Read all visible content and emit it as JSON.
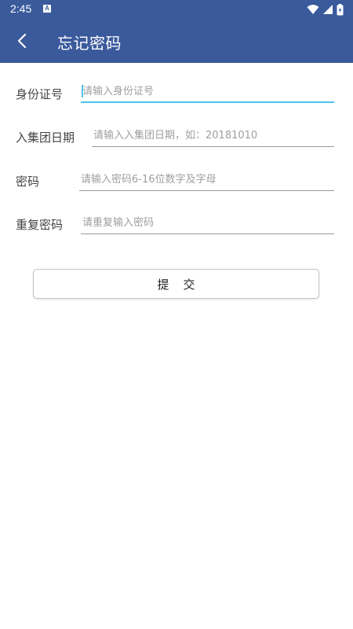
{
  "status_bar": {
    "time": "2:45",
    "notification_icon": "A",
    "icons": [
      "wifi-icon",
      "cellular-signal-icon",
      "battery-charging-icon"
    ]
  },
  "app_bar": {
    "title": "忘记密码",
    "back_icon": "chevron-left-icon",
    "background_color": "#3a5a9c"
  },
  "form": {
    "fields": [
      {
        "label": "身份证号",
        "placeholder": "请输入身份证号",
        "value": "",
        "focused": true
      },
      {
        "label": "入集团日期",
        "placeholder": "请输入入集团日期，如：20181010",
        "value": "",
        "focused": false
      },
      {
        "label": "密码",
        "placeholder": "请输入密码6-16位数字及字母",
        "value": "",
        "focused": false
      },
      {
        "label": "重复密码",
        "placeholder": "请重复输入密码",
        "value": "",
        "focused": false
      }
    ],
    "submit_label": "提交"
  },
  "colors": {
    "accent_focus": "#4fc3e8",
    "label_text": "#444444",
    "placeholder": "#9e9e9e"
  }
}
